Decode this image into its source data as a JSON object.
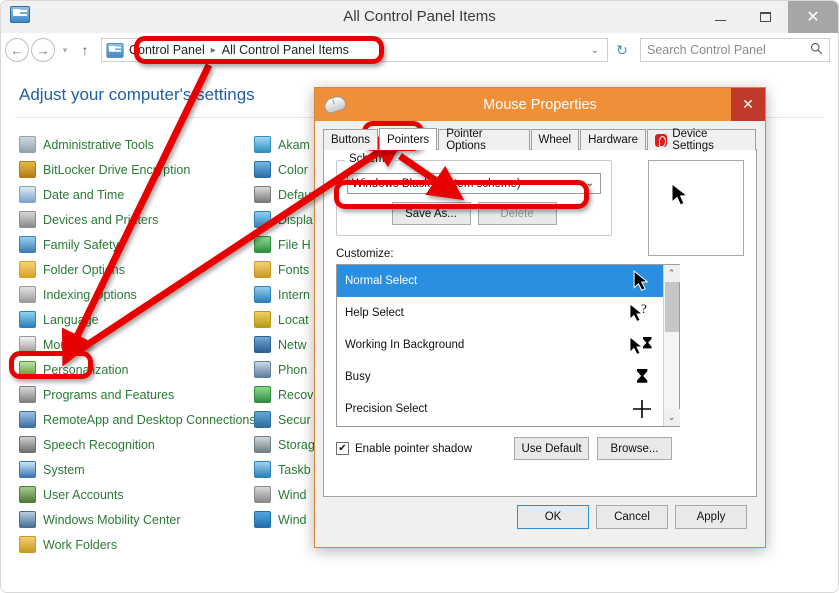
{
  "window": {
    "title": "All Control Panel Items",
    "icon": "control-panel-icon",
    "minimize_label": "–",
    "maximize_label": "□",
    "close_label": "✕"
  },
  "nav": {
    "back_label": "←",
    "forward_label": "→",
    "history_label": "▾",
    "up_label": "↑",
    "address": {
      "crumbs": [
        "Control Panel",
        "All Control Panel Items"
      ],
      "separator": "▸",
      "dropdown_label": "⌄"
    },
    "refresh_label": "↻",
    "search": {
      "placeholder": "Search Control Panel",
      "icon": "search-icon"
    }
  },
  "content": {
    "heading": "Adjust your computer's settings",
    "column1": [
      {
        "label": "Administrative Tools",
        "icon": "administrative-tools-icon"
      },
      {
        "label": "BitLocker Drive Encryption",
        "icon": "bitlocker-icon"
      },
      {
        "label": "Date and Time",
        "icon": "date-and-time-icon"
      },
      {
        "label": "Devices and Printers",
        "icon": "devices-and-printers-icon"
      },
      {
        "label": "Family Safety",
        "icon": "family-safety-icon"
      },
      {
        "label": "Folder Options",
        "icon": "folder-options-icon"
      },
      {
        "label": "Indexing Options",
        "icon": "indexing-options-icon"
      },
      {
        "label": "Language",
        "icon": "language-icon"
      },
      {
        "label": "Mouse",
        "icon": "mouse-icon"
      },
      {
        "label": "Personalization",
        "icon": "personalization-icon"
      },
      {
        "label": "Programs and Features",
        "icon": "programs-and-features-icon"
      },
      {
        "label": "RemoteApp and Desktop Connections",
        "icon": "remoteapp-icon"
      },
      {
        "label": "Speech Recognition",
        "icon": "speech-recognition-icon"
      },
      {
        "label": "System",
        "icon": "system-icon"
      },
      {
        "label": "User Accounts",
        "icon": "user-accounts-icon"
      },
      {
        "label": "Windows Mobility Center",
        "icon": "windows-mobility-center-icon"
      },
      {
        "label": "Work Folders",
        "icon": "work-folders-icon"
      }
    ],
    "column2": [
      {
        "label": "Akam",
        "icon": "akamai-netsession-icon"
      },
      {
        "label": "Color",
        "icon": "color-management-icon"
      },
      {
        "label": "Defau",
        "icon": "default-programs-icon"
      },
      {
        "label": "Displa",
        "icon": "display-icon"
      },
      {
        "label": "File H",
        "icon": "file-history-icon"
      },
      {
        "label": "Fonts",
        "icon": "fonts-icon"
      },
      {
        "label": "Intern",
        "icon": "internet-options-icon"
      },
      {
        "label": "Locat",
        "icon": "location-settings-icon"
      },
      {
        "label": "Netw",
        "icon": "network-sharing-icon"
      },
      {
        "label": "Phon",
        "icon": "phone-and-modem-icon"
      },
      {
        "label": "Recov",
        "icon": "recovery-icon"
      },
      {
        "label": "Secur",
        "icon": "security-maintenance-icon"
      },
      {
        "label": "Storag",
        "icon": "storage-spaces-icon"
      },
      {
        "label": "Taskb",
        "icon": "taskbar-navigation-icon"
      },
      {
        "label": "Wind",
        "icon": "windows-defender-icon"
      },
      {
        "label": "Wind",
        "icon": "windows-to-go-icon"
      }
    ]
  },
  "dialog": {
    "title": "Mouse Properties",
    "icon": "mouse-icon",
    "close_label": "✕",
    "tabs": [
      {
        "label": "Buttons",
        "active": false
      },
      {
        "label": "Pointers",
        "active": true
      },
      {
        "label": "Pointer Options",
        "active": false
      },
      {
        "label": "Wheel",
        "active": false
      },
      {
        "label": "Hardware",
        "active": false
      },
      {
        "label": "Device Settings",
        "active": false,
        "icon": "elan-device-icon"
      }
    ],
    "scheme": {
      "legend": "Scheme",
      "selected": "Windows Black (system scheme)",
      "caret": "⌄",
      "save_as_label": "Save As...",
      "delete_label": "Delete"
    },
    "customize_label": "Customize:",
    "cursors": [
      {
        "name": "Normal Select",
        "cursor": "normal-select-cursor",
        "selected": true
      },
      {
        "name": "Help Select",
        "cursor": "help-select-cursor",
        "selected": false
      },
      {
        "name": "Working In Background",
        "cursor": "working-in-background-cursor",
        "selected": false
      },
      {
        "name": "Busy",
        "cursor": "busy-cursor",
        "selected": false
      },
      {
        "name": "Precision Select",
        "cursor": "precision-select-cursor",
        "selected": false
      }
    ],
    "scroll": {
      "up_label": "⌃",
      "down_label": "⌄"
    },
    "shadow": {
      "label": "Enable pointer shadow",
      "checked": true,
      "check_glyph": "✔"
    },
    "use_default_label": "Use Default",
    "browse_label": "Browse...",
    "footer": {
      "ok_label": "OK",
      "cancel_label": "Cancel",
      "apply_label": "Apply"
    }
  },
  "annotations": {
    "color": "#e80000",
    "highlights": [
      {
        "name": "address-bar-highlight"
      },
      {
        "name": "mouse-item-highlight"
      },
      {
        "name": "pointers-tab-highlight"
      },
      {
        "name": "scheme-combo-highlight"
      }
    ]
  }
}
